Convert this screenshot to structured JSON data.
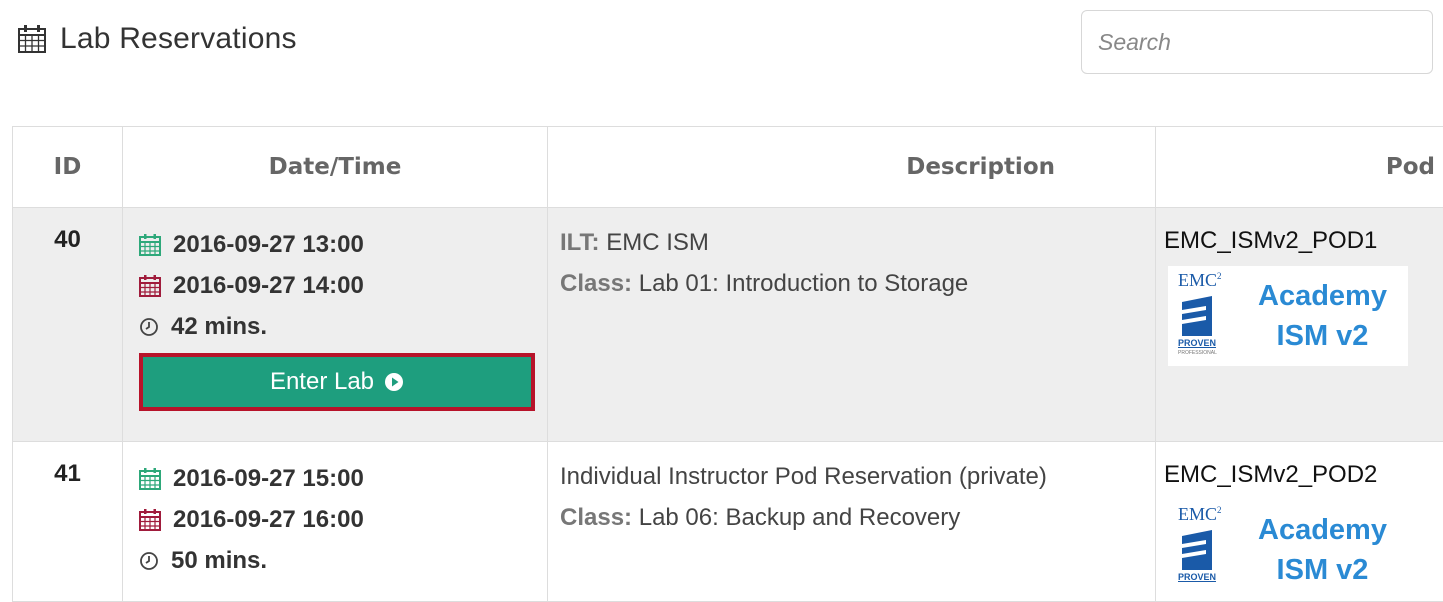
{
  "header": {
    "title": "Lab Reservations",
    "search_placeholder": "Search"
  },
  "table": {
    "columns": {
      "id": "ID",
      "datetime": "Date/Time",
      "description": "Description",
      "pod": "Pod"
    },
    "rows": [
      {
        "id": "40",
        "start": "2016-09-27 13:00",
        "end": "2016-09-27 14:00",
        "duration": "42 mins.",
        "enter_button": "Enter Lab",
        "desc_label_1": "ILT:",
        "desc_value_1": " EMC ISM",
        "class_label": "Class:",
        "class_value": " Lab 01: Introduction to Storage",
        "pod_name": "EMC_ISMv2_POD1",
        "pod_image": {
          "logo_text": "EMC",
          "logo_superscript": "2",
          "logo_badge": "PROVEN",
          "logo_subbadge": "PROFESSIONAL",
          "line1": "Academy",
          "line2": "ISM v2"
        }
      },
      {
        "id": "41",
        "start": "2016-09-27 15:00",
        "end": "2016-09-27 16:00",
        "duration": "50 mins.",
        "desc_value_1": "Individual Instructor Pod Reservation (private)",
        "class_label": "Class:",
        "class_value": " Lab 06: Backup and Recovery",
        "pod_name": "EMC_ISMv2_POD2",
        "pod_image": {
          "logo_text": "EMC",
          "logo_superscript": "2",
          "logo_badge": "PROVEN",
          "line1": "Academy",
          "line2": "ISM v2"
        }
      }
    ]
  },
  "colors": {
    "start_icon": "#2ea87a",
    "end_icon": "#a01c3c",
    "enter_button_bg": "#1e9e7e",
    "enter_button_border": "#b7132a",
    "pod_image_text": "#2a8ad4",
    "row_highlight_bg": "#eeeeee"
  }
}
